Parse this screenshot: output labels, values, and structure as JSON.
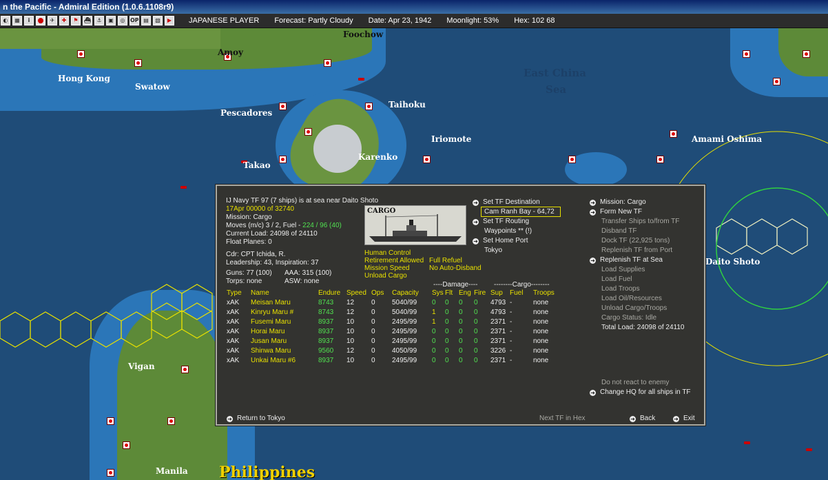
{
  "window": {
    "title": "n the Pacific - Admiral Edition (1.0.6.1108r9)"
  },
  "toolbar": {
    "player": "JAPANESE PLAYER",
    "forecast": "Forecast: Partly Cloudy",
    "date": "Date: Apr 23, 1942",
    "moonlight": "Moonlight: 53%",
    "hex": "Hex: 102 68",
    "buttons": [
      "sub-icon",
      "tf-icon",
      "info-icon",
      "rising-sun-icon",
      "plane-icon",
      "cross-icon",
      "flag-icon",
      "carrier-icon",
      "ship-icon",
      "base-icon",
      "globe-icon",
      "op-icon",
      "save-icon",
      "map-icon",
      "play-icon"
    ]
  },
  "map": {
    "labels": {
      "foochow": "Foochow",
      "amoy": "Amoy",
      "hongkong": "Hong Kong",
      "swatow": "Swatow",
      "pescadores": "Pescadores",
      "taihoku": "Taihoku",
      "iriomote": "Iriomote",
      "karenko": "Karenko",
      "takao": "Takao",
      "amami": "Amami Oshima",
      "eastchina": "East China",
      "sea": "Sea",
      "daito": "Daito Shoto",
      "vigan": "Vigan",
      "manila": "Manila",
      "philippines": "Philippines"
    }
  },
  "panel": {
    "header": {
      "tf_line": "IJ Navy TF 97 (7 ships) is at sea near Daito Shoto",
      "time": "17Apr 00000 of 32740",
      "mission": "Mission: Cargo",
      "moves_prefix": "Moves (m/c)  3 / 2, Fuel -",
      "moves_fuel": "224 / 96 (40)",
      "current_load": "Current Load:  24098 of 24110",
      "float_planes": "Float Planes:  0",
      "cdr": "Cdr: CPT  Ichida, R.",
      "leadership": "Leadership: 43, Inspiration: 37",
      "guns": "Guns: 77 (100)",
      "aaa": "AAA: 315 (100)",
      "torps": "Torps: none",
      "asw": "ASW: none"
    },
    "image_caption": "CARGO",
    "control": {
      "human": "Human Control",
      "retirement": "Retirement Allowed",
      "refuel": "Full Refuel",
      "speed": "Mission Speed",
      "disband": "No Auto-Disband",
      "unload": "Unload Cargo"
    },
    "middle": {
      "set_dest": "Set TF Destination",
      "dest_value": "Cam Ranh Bay - 64,72",
      "set_routing": "Set TF Routing",
      "waypoints": "Waypoints  ** (!)",
      "set_home": "Set Home Port",
      "home_value": "Tokyo"
    },
    "right": {
      "mission": "Mission: Cargo",
      "form_new": "Form New TF",
      "transfer": "Transfer Ships to/from TF",
      "disband": "Disband TF",
      "dock": "Dock TF (22,925 tons)",
      "replenish_port": "Replenish TF from Port",
      "replenish_sea": "Replenish TF at Sea",
      "load_supplies": "Load Supplies",
      "load_fuel": "Load Fuel",
      "load_troops": "Load Troops",
      "load_oil": "Load Oil/Resources",
      "unload": "Unload Cargo/Troops",
      "cargo_status": "Cargo Status: Idle",
      "total_load": "Total Load: 24098 of 24110",
      "no_react": "Do not react to enemy",
      "change_hq": "Change HQ for all ships in TF"
    },
    "table": {
      "group_damage": "----Damage----",
      "group_cargo": "--------Cargo--------",
      "headers": [
        "Type",
        "Name",
        "Endure",
        "Speed",
        "Ops",
        "Capacity",
        "Sys",
        "Flt",
        "Eng",
        "Fire",
        "Sup",
        "Fuel",
        "Troops"
      ],
      "rows": [
        [
          "xAK",
          "Meisan Maru",
          "8743",
          "12",
          "0",
          "5040/99",
          "0",
          "0",
          "0",
          "0",
          "4793",
          "-",
          "none"
        ],
        [
          "xAK",
          "Kinryu Maru #",
          "8743",
          "12",
          "0",
          "5040/99",
          "1",
          "0",
          "0",
          "0",
          "4793",
          "-",
          "none"
        ],
        [
          "xAK",
          "Fusemi Maru",
          "8937",
          "10",
          "0",
          "2495/99",
          "1",
          "0",
          "0",
          "0",
          "2371",
          "-",
          "none"
        ],
        [
          "xAK",
          "Horai Maru",
          "8937",
          "10",
          "0",
          "2495/99",
          "0",
          "0",
          "0",
          "0",
          "2371",
          "-",
          "none"
        ],
        [
          "xAK",
          "Jusan Maru",
          "8937",
          "10",
          "0",
          "2495/99",
          "0",
          "0",
          "0",
          "0",
          "2371",
          "-",
          "none"
        ],
        [
          "xAK",
          "Shinwa Maru",
          "9560",
          "12",
          "0",
          "4050/99",
          "0",
          "0",
          "0",
          "0",
          "3226",
          "-",
          "none"
        ],
        [
          "xAK",
          "Unkai Maru #6",
          "8937",
          "10",
          "0",
          "2495/99",
          "0",
          "0",
          "0",
          "0",
          "2371",
          "-",
          "none"
        ]
      ]
    },
    "footer": {
      "return": "Return to Tokyo",
      "next_tf": "Next TF in Hex",
      "back": "Back",
      "exit": "Exit"
    }
  },
  "colors": {
    "highlight": "#e8e000",
    "green": "#50e050",
    "panel": "#333330"
  }
}
